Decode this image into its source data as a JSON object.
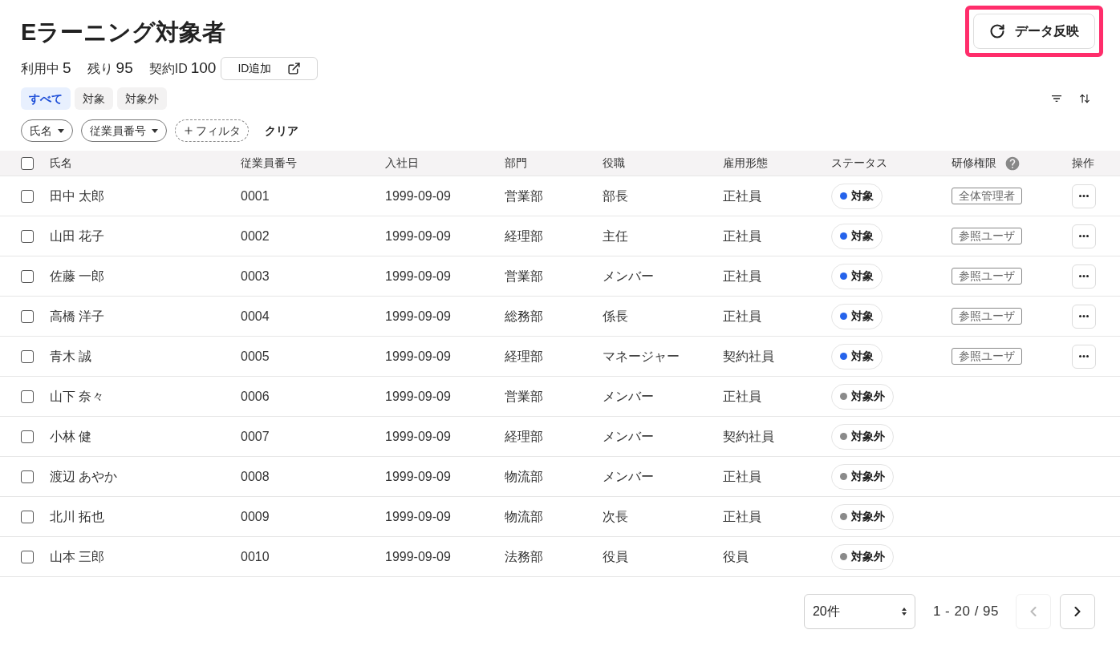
{
  "page": {
    "title": "Eラーニング対象者"
  },
  "refresh_button": {
    "label": "データ反映",
    "highlighted": true
  },
  "stats": [
    {
      "label": "利用中",
      "value": "5"
    },
    {
      "label": "残り",
      "value": "95"
    },
    {
      "label": "契約ID",
      "value": "100"
    }
  ],
  "add_id_button": {
    "label": "ID追加"
  },
  "tabs": [
    {
      "label": "すべて",
      "selected": true
    },
    {
      "label": "対象",
      "selected": false
    },
    {
      "label": "対象外",
      "selected": false
    }
  ],
  "filters": [
    {
      "kind": "dropdown",
      "label": "氏名"
    },
    {
      "kind": "dropdown",
      "label": "従業員番号"
    },
    {
      "kind": "add",
      "label": "フィルタ"
    },
    {
      "kind": "clear",
      "label": "クリア"
    }
  ],
  "table": {
    "select_all": {
      "checked": false
    },
    "columns": [
      {
        "label": "氏名"
      },
      {
        "label": "従業員番号"
      },
      {
        "label": "入社日"
      },
      {
        "label": "部門"
      },
      {
        "label": "役職"
      },
      {
        "label": "雇用形態"
      },
      {
        "label": "ステータス"
      },
      {
        "label": "研修権限",
        "help": true
      },
      {
        "label": "操作"
      }
    ],
    "rows": [
      {
        "checked": false,
        "name": "田中 太郎",
        "employee_no": "0001",
        "hire_date": "1999-09-09",
        "department": "営業部",
        "position": "部長",
        "employment": "正社員",
        "status": {
          "label": "対象",
          "color": "#2563eb"
        },
        "role": "全体管理者",
        "actions": true
      },
      {
        "checked": false,
        "name": "山田 花子",
        "employee_no": "0002",
        "hire_date": "1999-09-09",
        "department": "経理部",
        "position": "主任",
        "employment": "正社員",
        "status": {
          "label": "対象",
          "color": "#2563eb"
        },
        "role": "参照ユーザ",
        "actions": true
      },
      {
        "checked": false,
        "name": "佐藤 一郎",
        "employee_no": "0003",
        "hire_date": "1999-09-09",
        "department": "営業部",
        "position": "メンバー",
        "employment": "正社員",
        "status": {
          "label": "対象",
          "color": "#2563eb"
        },
        "role": "参照ユーザ",
        "actions": true
      },
      {
        "checked": false,
        "name": "高橋 洋子",
        "employee_no": "0004",
        "hire_date": "1999-09-09",
        "department": "総務部",
        "position": "係長",
        "employment": "正社員",
        "status": {
          "label": "対象",
          "color": "#2563eb"
        },
        "role": "参照ユーザ",
        "actions": true
      },
      {
        "checked": false,
        "name": "青木 誠",
        "employee_no": "0005",
        "hire_date": "1999-09-09",
        "department": "経理部",
        "position": "マネージャー",
        "employment": "契約社員",
        "status": {
          "label": "対象",
          "color": "#2563eb"
        },
        "role": "参照ユーザ",
        "actions": true
      },
      {
        "checked": false,
        "name": "山下 奈々",
        "employee_no": "0006",
        "hire_date": "1999-09-09",
        "department": "営業部",
        "position": "メンバー",
        "employment": "正社員",
        "status": {
          "label": "対象外",
          "color": "#8a8a8a"
        },
        "actions": false
      },
      {
        "checked": false,
        "name": "小林 健",
        "employee_no": "0007",
        "hire_date": "1999-09-09",
        "department": "経理部",
        "position": "メンバー",
        "employment": "契約社員",
        "status": {
          "label": "対象外",
          "color": "#8a8a8a"
        },
        "actions": false
      },
      {
        "checked": false,
        "name": "渡辺 あやか",
        "employee_no": "0008",
        "hire_date": "1999-09-09",
        "department": "物流部",
        "position": "メンバー",
        "employment": "正社員",
        "status": {
          "label": "対象外",
          "color": "#8a8a8a"
        },
        "actions": false
      },
      {
        "checked": false,
        "name": "北川 拓也",
        "employee_no": "0009",
        "hire_date": "1999-09-09",
        "department": "物流部",
        "position": "次長",
        "employment": "正社員",
        "status": {
          "label": "対象外",
          "color": "#8a8a8a"
        },
        "actions": false
      },
      {
        "checked": false,
        "name": "山本 三郎",
        "employee_no": "0010",
        "hire_date": "1999-09-09",
        "department": "法務部",
        "position": "役員",
        "employment": "役員",
        "status": {
          "label": "対象外",
          "color": "#8a8a8a"
        },
        "actions": false
      }
    ]
  },
  "pagination": {
    "page_size": "20件",
    "range": "1 - 20 / 95",
    "prev_disabled": true,
    "next_disabled": false
  }
}
